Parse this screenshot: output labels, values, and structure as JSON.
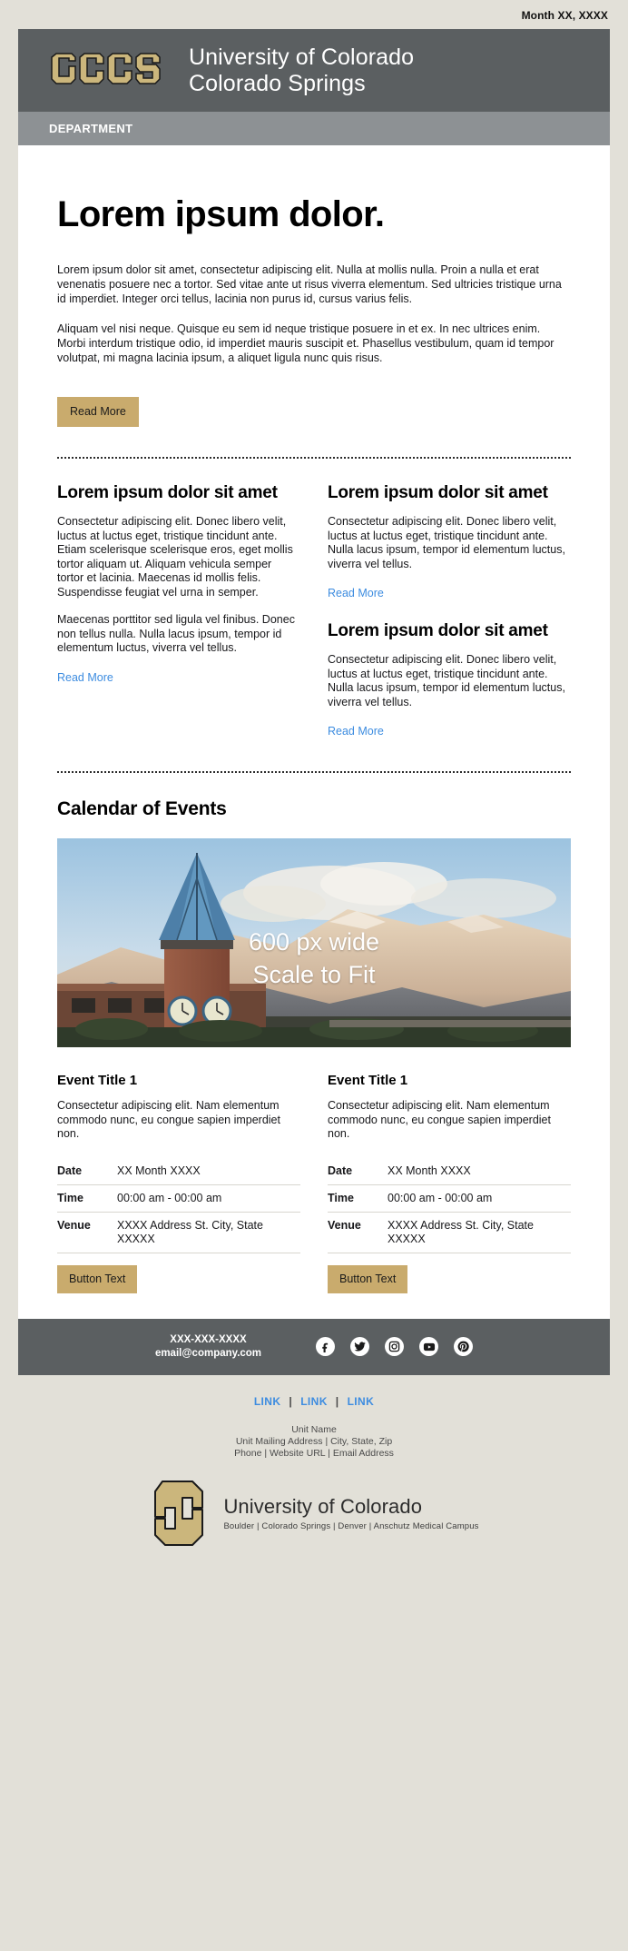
{
  "date_line": "Month XX, XXXX",
  "masthead": {
    "logo_alt": "UCCS",
    "title_line1": "University of Colorado",
    "title_line2": "Colorado Springs"
  },
  "department_bar": {
    "label": "DEPARTMENT"
  },
  "hero": {
    "title": "Lorem ipsum dolor.",
    "paragraph1": "Lorem ipsum dolor sit amet, consectetur adipiscing elit. Nulla at mollis nulla. Proin a nulla et erat venenatis posuere nec a tortor. Sed vitae ante ut risus viverra elementum. Sed ultricies tristique urna id imperdiet. Integer orci tellus, lacinia non purus id, cursus varius felis.",
    "paragraph2": "Aliquam vel nisi neque. Quisque eu sem id neque tristique posuere in et ex. In nec ultrices enim. Morbi interdum tristique odio, id imperdiet mauris suscipit et. Phasellus vestibulum, quam id tempor volutpat, mi magna lacinia ipsum, a aliquet ligula nunc quis risus.",
    "button_label": "Read More"
  },
  "columns": {
    "left": {
      "heading": "Lorem ipsum dolor sit amet",
      "paragraph1": "Consectetur adipiscing elit. Donec libero velit, luctus at luctus eget, tristique tincidunt ante. Etiam scelerisque scelerisque eros, eget mollis tortor aliquam ut. Aliquam vehicula semper tortor et lacinia. Maecenas id mollis felis. Suspendisse feugiat vel urna in semper.",
      "paragraph2": "Maecenas porttitor sed ligula vel finibus. Donec non tellus nulla. Nulla lacus ipsum, tempor id elementum luctus, viverra vel tellus.",
      "link": "Read More"
    },
    "right_top": {
      "heading": "Lorem ipsum dolor sit amet",
      "paragraph": "Consectetur adipiscing elit. Donec libero velit, luctus at luctus eget, tristique tincidunt ante. Nulla lacus ipsum, tempor id elementum luctus, viverra vel tellus.",
      "link": "Read More"
    },
    "right_bottom": {
      "heading": "Lorem ipsum dolor sit amet",
      "paragraph": "Consectetur adipiscing elit. Donec libero velit, luctus at luctus eget, tristique tincidunt ante. Nulla lacus ipsum, tempor id elementum luctus, viverra vel tellus.",
      "link": "Read More"
    }
  },
  "calendar": {
    "title": "Calendar of Events",
    "image_overlay_line1": "600 px wide",
    "image_overlay_line2": "Scale to Fit",
    "events": [
      {
        "title": "Event Title 1",
        "description": "Consectetur adipiscing elit. Nam elementum commodo nunc, eu congue sapien imperdiet non.",
        "rows": [
          {
            "label": "Date",
            "value": "XX Month XXXX"
          },
          {
            "label": "Time",
            "value": "00:00 am - 00:00 am"
          },
          {
            "label": "Venue",
            "value": "XXXX Address St. City, State XXXXX"
          }
        ],
        "button_label": "Button Text"
      },
      {
        "title": "Event Title 1",
        "description": "Consectetur adipiscing elit. Nam elementum commodo nunc, eu congue sapien imperdiet non.",
        "rows": [
          {
            "label": "Date",
            "value": "XX Month XXXX"
          },
          {
            "label": "Time",
            "value": "00:00 am - 00:00 am"
          },
          {
            "label": "Venue",
            "value": "XXXX Address St. City, State XXXXX"
          }
        ],
        "button_label": "Button Text"
      }
    ]
  },
  "footer": {
    "phone": "XXX-XXX-XXXX",
    "email": "email@company.com",
    "social": [
      {
        "name": "facebook-icon"
      },
      {
        "name": "twitter-icon"
      },
      {
        "name": "instagram-icon"
      },
      {
        "name": "youtube-icon"
      },
      {
        "name": "pinterest-icon"
      }
    ]
  },
  "bottom": {
    "link1": "LINK",
    "link2": "LINK",
    "link3": "LINK",
    "separator": "|",
    "unit_name": "Unit Name",
    "unit_address": "Unit Mailing Address | City, State, Zip",
    "unit_contact": "Phone | Website URL | Email Address",
    "cu_name": "University of Colorado",
    "cu_campuses": "Boulder | Colorado Springs | Denver | Anschutz Medical Campus"
  },
  "colors": {
    "page_background": "#e2e0d8",
    "masthead": "#5b5f61",
    "department_bar": "#8d9194",
    "gold_button": "#c9ab6d",
    "link_blue": "#3d8ce0",
    "uccs_gold": "#cbb67c"
  }
}
